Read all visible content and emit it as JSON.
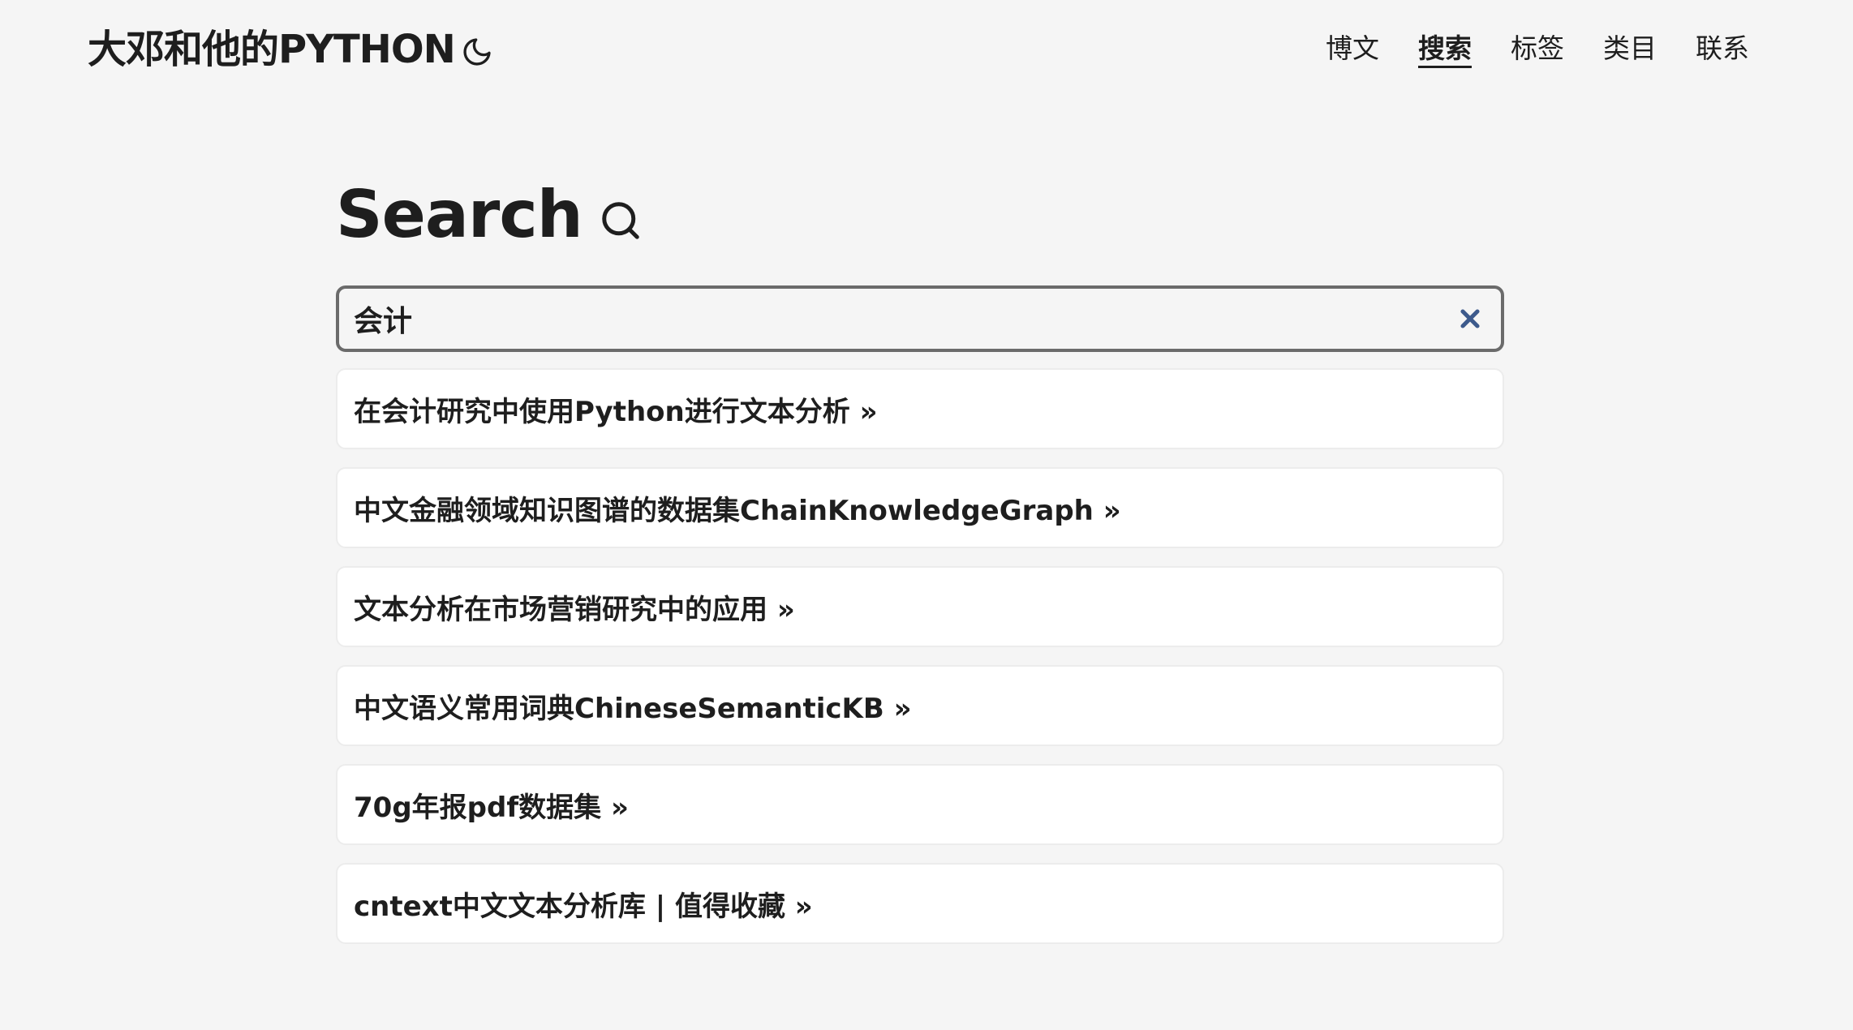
{
  "site": {
    "title": "大邓和他的PYTHON",
    "theme_toggle_icon": "moon-icon"
  },
  "nav": {
    "items": [
      {
        "label": "博文",
        "active": false
      },
      {
        "label": "搜索",
        "active": true
      },
      {
        "label": "标签",
        "active": false
      },
      {
        "label": "类目",
        "active": false
      },
      {
        "label": "联系",
        "active": false
      }
    ]
  },
  "page": {
    "heading": "Search",
    "heading_icon": "search-icon"
  },
  "search": {
    "value": "会计",
    "clear_icon": "close-icon",
    "clear_color": "#3d5a8c"
  },
  "results": [
    {
      "title": "在会计研究中使用Python进行文本分析 »"
    },
    {
      "title": "中文金融领域知识图谱的数据集ChainKnowledgeGraph »"
    },
    {
      "title": "文本分析在市场营销研究中的应用 »"
    },
    {
      "title": "中文语义常用词典ChineseSemanticKB »"
    },
    {
      "title": "70g年报pdf数据集 »"
    },
    {
      "title": "cntext中文文本分析库 | 值得收藏 »"
    }
  ]
}
